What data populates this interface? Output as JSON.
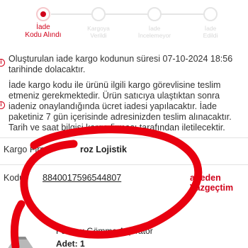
{
  "stepper": {
    "steps": [
      {
        "label_1": "İade",
        "label_2": "Kodu Alındı",
        "active": true
      },
      {
        "label_1": "Kargoya",
        "label_2": "Verildi",
        "active": false
      },
      {
        "label_1": "İade",
        "label_2": "İncelemeyor",
        "active": false
      },
      {
        "label_1": "İade",
        "label_2": "Edildi",
        "active": false
      }
    ]
  },
  "notice_1": {
    "icon": "info-icon",
    "line_1": "Oluşturulan iade kargo kodunun süresi 07-10-2024 18:56",
    "line_2": "tarihinde dolacaktır."
  },
  "notice_2": {
    "icon": "info-icon",
    "line_1": "İade kargo kodu ile ürünü ilgili kargo görevlisine teslim",
    "line_2": "etmeniz gerekmektedir. Ürün satıcıya ulaştıktan sonra",
    "line_3": "iadeniz onaylandığında ücret iadesi yapılacaktır. İade",
    "line_4": "paketiniz 7 gün içerisinde adresinizden teslim alınacaktır.",
    "line_5": "Tarih ve saat bilgisi kargo firması tarafından iletilecektir."
  },
  "cargo": {
    "company_label": "Kargo Firm",
    "company_value": "roz Lojistik",
    "code_label": "Kodu:",
    "code_value": "8840017596544807",
    "cancel_label": "adeden Vazgeçtim"
  },
  "product": {
    "name": "F9 Inox Gömme Aspiratör",
    "quantity": "Adet: 1"
  },
  "colors": {
    "accent": "#d0021b",
    "scribble": "#e8000f"
  }
}
